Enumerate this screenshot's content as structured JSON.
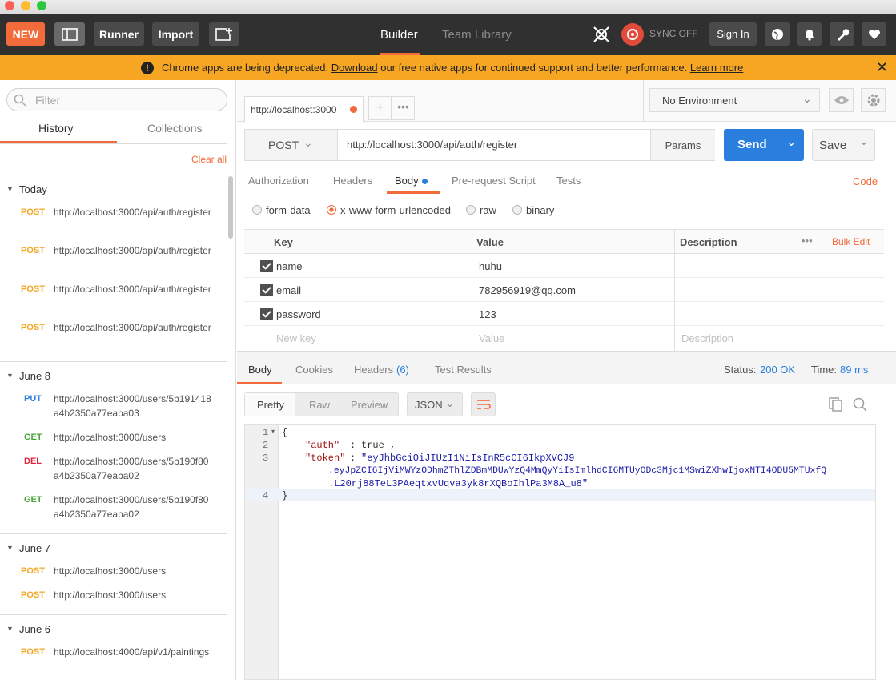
{
  "header": {
    "new_label": "NEW",
    "runner_label": "Runner",
    "import_label": "Import",
    "builder_label": "Builder",
    "team_library_label": "Team Library",
    "sync_label": "SYNC OFF",
    "signin_label": "Sign In"
  },
  "banner": {
    "message_before": "Chrome apps are being deprecated.",
    "link_download": "Download",
    "message_after": "our free native apps for continued support and better performance.",
    "link_learn": "Learn more"
  },
  "sidebar": {
    "filter_placeholder": "Filter",
    "tabs": [
      "History",
      "Collections"
    ],
    "clear_all": "Clear all",
    "sections": [
      {
        "title": "Today",
        "items": [
          {
            "method": "POST",
            "url": "http://localhost:3000/api/auth/register"
          },
          {
            "method": "POST",
            "url": "http://localhost:3000/api/auth/register"
          },
          {
            "method": "POST",
            "url": "http://localhost:3000/api/auth/register"
          },
          {
            "method": "POST",
            "url": "http://localhost:3000/api/auth/register"
          }
        ]
      },
      {
        "title": "June 8",
        "items": [
          {
            "method": "PUT",
            "url": "http://localhost:3000/users/5b191418a4b2350a77eaba03"
          },
          {
            "method": "GET",
            "url": "http://localhost:3000/users"
          },
          {
            "method": "DEL",
            "url": "http://localhost:3000/users/5b190f80a4b2350a77eaba02"
          },
          {
            "method": "GET",
            "url": "http://localhost:3000/users/5b190f80a4b2350a77eaba02"
          }
        ]
      },
      {
        "title": "June 7",
        "items": [
          {
            "method": "POST",
            "url": "http://localhost:3000/users"
          },
          {
            "method": "POST",
            "url": "http://localhost:3000/users"
          }
        ]
      },
      {
        "title": "June 6",
        "items": [
          {
            "method": "POST",
            "url": "http://localhost:4000/api/v1/paintings"
          }
        ]
      }
    ]
  },
  "request": {
    "tab_url": "http://localhost:3000",
    "environment": "No Environment",
    "method": "POST",
    "url": "http://localhost:3000/api/auth/register",
    "params_label": "Params",
    "send_label": "Send",
    "save_label": "Save",
    "tabs": [
      "Authorization",
      "Headers",
      "Body",
      "Pre-request Script",
      "Tests"
    ],
    "code_label": "Code",
    "body_types": [
      "form-data",
      "x-www-form-urlencoded",
      "raw",
      "binary"
    ],
    "table_headers": {
      "key": "Key",
      "value": "Value",
      "description": "Description",
      "bulk_edit": "Bulk Edit"
    },
    "rows": [
      {
        "key": "name",
        "value": "huhu"
      },
      {
        "key": "email",
        "value": "782956919@qq.com"
      },
      {
        "key": "password",
        "value": "123"
      }
    ],
    "placeholders": {
      "key": "New key",
      "value": "Value",
      "description": "Description"
    }
  },
  "response": {
    "tabs": [
      "Body",
      "Cookies",
      "Headers",
      "Test Results"
    ],
    "headers_count": "(6)",
    "status_label": "Status:",
    "status_value": "200 OK",
    "time_label": "Time:",
    "time_value": "89 ms",
    "view_modes": [
      "Pretty",
      "Raw",
      "Preview"
    ],
    "format": "JSON",
    "line_numbers": [
      "1",
      "2",
      "3",
      "4"
    ],
    "code_lines": {
      "l1": "{",
      "auth_key": "\"auth\"",
      "auth_val": "true",
      "token_key": "\"token\"",
      "token_1": "\"eyJhbGciOiJIUzI1NiIsInR5cCI6IkpXVCJ9",
      "token_2": ".eyJpZCI6IjViMWYzODhmZThlZDBmMDUwYzQ4MmQyYiIsImlhdCI6MTUyODc3Mjc1MSwiZXhwIjoxNTI4ODU5MTUxfQ",
      "token_3": ".L20rj88TeL3PAeqtxvUqva3yk8rXQBoIhlPa3M8A_u8\"",
      "l4": "}"
    }
  },
  "colors": {
    "orange": "#f26b3a",
    "blue": "#2a7ede",
    "header": "#303030",
    "banner": "#f7a623"
  }
}
